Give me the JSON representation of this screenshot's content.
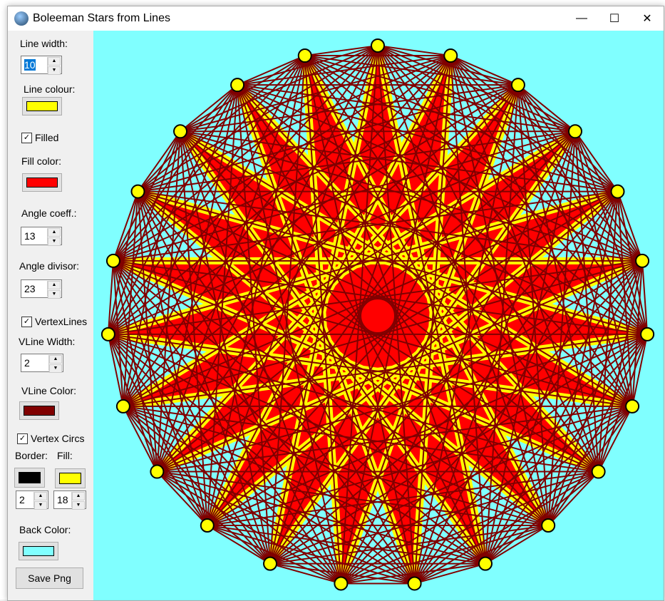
{
  "window": {
    "title": "Boleeman Stars from Lines",
    "minimize": "—",
    "maximize": "☐",
    "close": "✕"
  },
  "panel": {
    "line_width_label": "Line width:",
    "line_width": "10",
    "line_colour_label": "Line colour:",
    "line_colour": "#ffff00",
    "filled_label": "Filled",
    "filled": true,
    "fill_color_label": "Fill color:",
    "fill_color": "#ff0000",
    "angle_coeff_label": "Angle coeff.:",
    "angle_coeff": "13",
    "angle_divisor_label": "Angle divisor:",
    "angle_divisor": "23",
    "vertex_lines_label": "VertexLines",
    "vertex_lines": true,
    "vline_width_label": "VLine Width:",
    "vline_width": "2",
    "vline_color_label": "VLine Color:",
    "vline_color": "#800000",
    "vertex_circs_label": "Vertex Circs",
    "vertex_circs": true,
    "border_label": "Border:",
    "fill_label": "Fill:",
    "border_color": "#000000",
    "circle_fill_color": "#ffff00",
    "border_width": "2",
    "circle_size": "18",
    "back_color_label": "Back Color:",
    "back_color": "#80ffff",
    "save_label": "Save Png"
  }
}
